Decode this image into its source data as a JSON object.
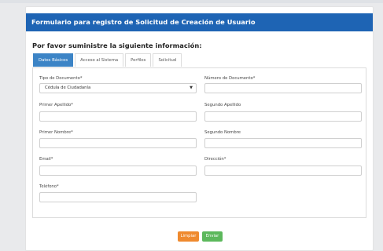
{
  "form": {
    "title": "Formulario para registro de Solicitud de Creación de Usuario",
    "subtitle": "Por favor suministre la siguiente información:"
  },
  "tabs": [
    {
      "label": "Datos Básicos",
      "active": true
    },
    {
      "label": "Acceso al Sistema",
      "active": false
    },
    {
      "label": "Perfiles",
      "active": false
    },
    {
      "label": "Solicitud",
      "active": false
    }
  ],
  "fields": {
    "tipo_documento": {
      "label": "Tipo de Documento*",
      "value": "Cédula de Ciudadanía"
    },
    "numero_documento": {
      "label": "Número de Documento*",
      "value": ""
    },
    "primer_apellido": {
      "label": "Primer Apellido*",
      "value": ""
    },
    "segundo_apellido": {
      "label": "Segundo Apellido",
      "value": ""
    },
    "primer_nombre": {
      "label": "Primer Nombre*",
      "value": ""
    },
    "segundo_nombre": {
      "label": "Segundo Nombre",
      "value": ""
    },
    "email": {
      "label": "Email*",
      "value": ""
    },
    "direccion": {
      "label": "Dirección*",
      "value": ""
    },
    "telefono": {
      "label": "Teléfono*",
      "value": ""
    }
  },
  "buttons": {
    "clear": "Limpiar",
    "send": "Enviar"
  },
  "colors": {
    "header": "#1e64b4",
    "tab_active": "#3c84c6",
    "clear_button": "#ef8a2e",
    "send_button": "#5cb85c"
  }
}
